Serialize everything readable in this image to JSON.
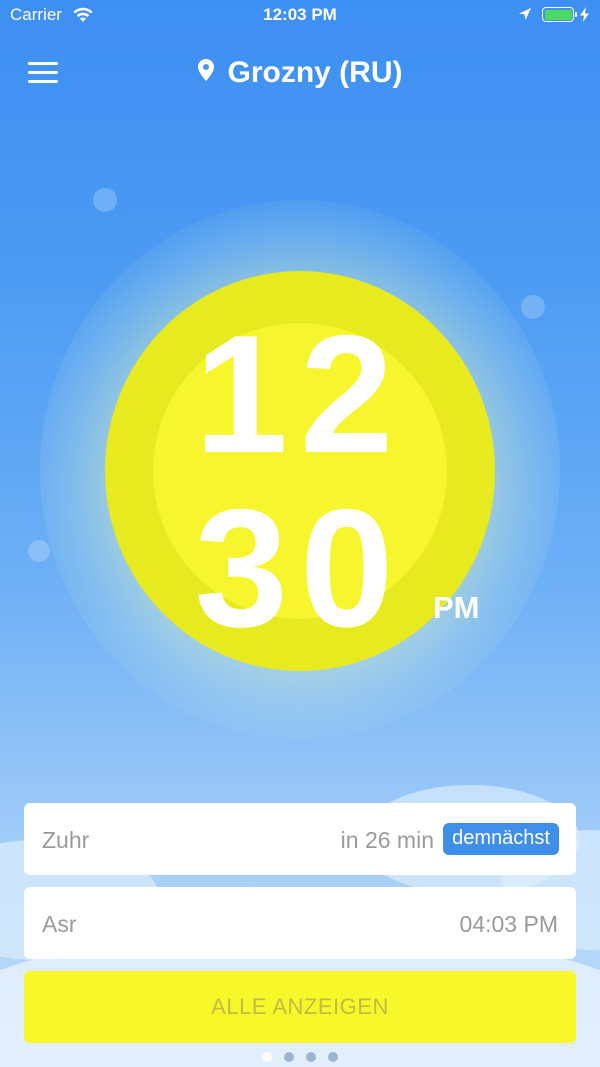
{
  "status_bar": {
    "carrier": "Carrier",
    "time": "12:03 PM",
    "battery_color": "#4cd964"
  },
  "header": {
    "location": "Grozny (RU)",
    "menu_icon": "hamburger-menu-icon",
    "pin_icon": "location-pin-icon"
  },
  "clock": {
    "hour": "12",
    "minute": "30",
    "ampm": "PM"
  },
  "prayers": [
    {
      "name": "Zuhr",
      "value": "in 26 min",
      "badge": "demnächst"
    },
    {
      "name": "Asr",
      "value": "04:03 PM"
    }
  ],
  "show_all_label": "ALLE ANZEIGEN",
  "pager": {
    "count": 4,
    "active": 0
  },
  "colors": {
    "sky_top": "#3d8ff2",
    "sun_outer": "#e7ea1e",
    "sun_inner": "#f7f52d",
    "badge": "#3f8fea",
    "button": "#f8f72a"
  }
}
